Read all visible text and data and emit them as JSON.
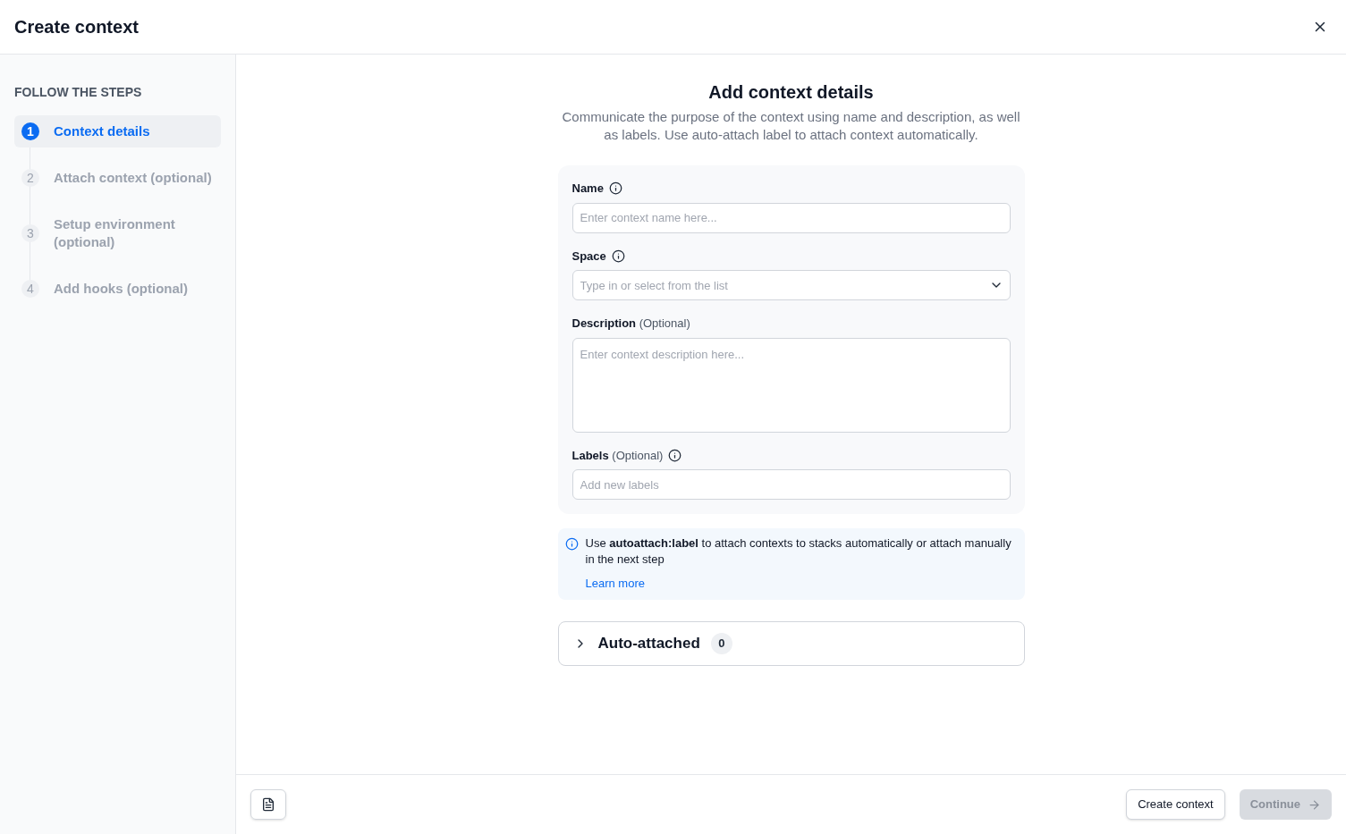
{
  "window": {
    "title": "Create context"
  },
  "sidebar": {
    "heading": "FOLLOW THE STEPS",
    "steps": [
      {
        "number": "1",
        "label": "Context details",
        "selected": true
      },
      {
        "number": "2",
        "label": "Attach context (optional)",
        "selected": false
      },
      {
        "number": "3",
        "label": "Setup environment (optional)",
        "selected": false
      },
      {
        "number": "4",
        "label": "Add hooks (optional)",
        "selected": false
      }
    ]
  },
  "main": {
    "title": "Add context details",
    "subtitle": "Communicate the purpose of the context using name and description, as well as labels. Use auto-attach label to attach context automatically.",
    "fields": [
      {
        "kind": "input",
        "label": "Name",
        "info": true,
        "placeholder": "Enter context name here..."
      },
      {
        "kind": "select",
        "label": "Space",
        "info": true,
        "placeholder": "Type in or select from the list"
      },
      {
        "kind": "textarea",
        "label": "Description",
        "suffix": "(Optional)",
        "info": false,
        "placeholder": "Enter context description here..."
      },
      {
        "kind": "input",
        "label": "Labels",
        "suffix": "(Optional)",
        "info": true,
        "placeholder": "Add new labels"
      }
    ],
    "notice": {
      "text": "Use **autoattach:label** to attach contexts to stacks automatically or attach manually in the next step",
      "link": "Learn more"
    },
    "accordion": {
      "title": "Auto-attached",
      "count": "0",
      "expanded": false
    }
  },
  "footer": {
    "buttons": [
      {
        "label": "Create context",
        "disabled": false,
        "kind": "secondary"
      },
      {
        "label": "Continue",
        "disabled": true,
        "kind": "primary"
      }
    ]
  }
}
